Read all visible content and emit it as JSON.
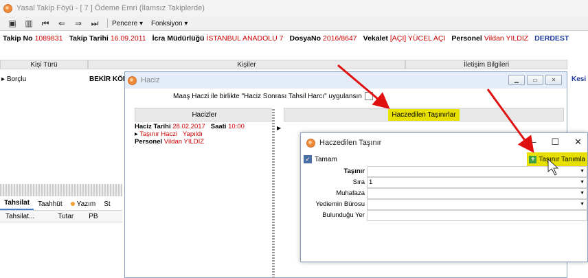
{
  "window": {
    "title": "Yasal Takip Föyü - [ 7 ] Ödeme Emri (İlamsız Takiplerde)"
  },
  "toolbar": {
    "menu_pencere": "Pencere ▾",
    "menu_fonksiyon": "Fonksiyon ▾"
  },
  "info": {
    "takip_no_label": "Takip No",
    "takip_no": "1089831",
    "takip_tarihi_label": "Takip Tarihi",
    "takip_tarihi": "16.09.2011",
    "icra_label": "İcra Müdürlüğü",
    "icra": "İSTANBUL ANADOLU 7",
    "dosya_label": "DosyaNo",
    "dosya": "2016/8647",
    "vekalet_label": "Vekalet",
    "vekalet": "[AÇI] YÜCEL AÇI",
    "personel_label": "Personel",
    "personel": "Vildan YILDIZ",
    "status": "DERDEST"
  },
  "grid": {
    "col_kisi_turu": "Kişi Türü",
    "col_kisiler": "Kişiler",
    "col_iletisim": "İletişim Bilgileri",
    "row_type": "Borçlu",
    "row_name": "BEKİR KÖR",
    "kesi": "Kesi"
  },
  "bottom_tabs": [
    "Tahsilat",
    "Taahhüt",
    "Yazım",
    "St"
  ],
  "bottom_cols": [
    "Tahsilat...",
    "Tutar",
    "PB"
  ],
  "haciz": {
    "title": "Haciz",
    "maas_text": "Maaş Haczi ile birlikte \"Haciz Sonrası Tahsil Harcı\" uygulansın",
    "left_header": "Hacizler",
    "right_header": "Haczedilen Taşınırlar",
    "entry": {
      "tarih_label": "Haciz Tarihi",
      "tarih": "28.02.2017",
      "saat_label": "Saati",
      "saat": "10:00",
      "type": "Taşınır Haczi",
      "status": "Yapıldı",
      "personel_label": "Personel",
      "personel": "Vildan YILDIZ"
    }
  },
  "dialog": {
    "title": "Haczedilen Taşınır",
    "ok_label": "Tamam",
    "add_label": "Taşınır Tanımla",
    "fields": [
      {
        "label": "Taşınır",
        "value": ""
      },
      {
        "label": "Sıra",
        "value": "1"
      },
      {
        "label": "Muhafaza",
        "value": ""
      },
      {
        "label": "Yediemin Bürosu",
        "value": ""
      },
      {
        "label": "Bulunduğu Yer",
        "value": ""
      }
    ]
  },
  "colors": {
    "highlight": "#e8e000",
    "arrow": "#e01010",
    "value_red": "#cc0000"
  }
}
